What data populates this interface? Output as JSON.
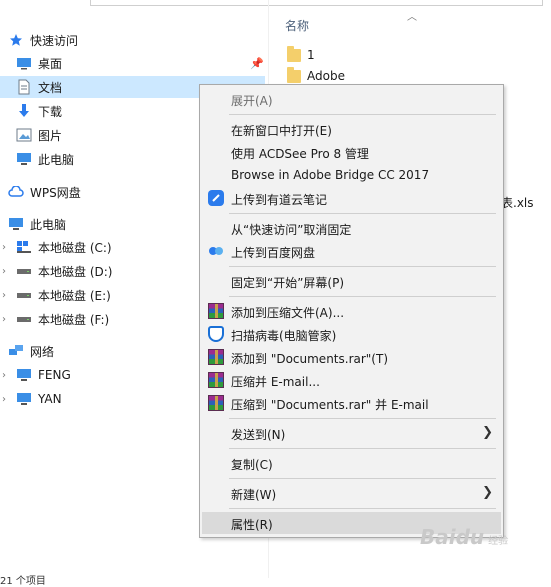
{
  "nav": {
    "quick_access": "快速访问",
    "desktop": "桌面",
    "documents": "文档",
    "downloads": "下载",
    "pictures": "图片",
    "this_pc_q": "此电脑",
    "wps": "WPS网盘",
    "this_pc": "此电脑",
    "disk_c": "本地磁盘 (C:)",
    "disk_d": "本地磁盘 (D:)",
    "disk_e": "本地磁盘 (E:)",
    "disk_f": "本地磁盘 (F:)",
    "network": "网络",
    "feng": "FENG",
    "yan": "YAN"
  },
  "files": {
    "column_name": "名称",
    "items": [
      "1",
      "Adobe"
    ],
    "xls_tail": "表.xls"
  },
  "menu": {
    "expand": "展开(A)",
    "open_new_window": "在新窗口中打开(E)",
    "acdsee": "使用 ACDSee Pro 8 管理",
    "bridge": "Browse in Adobe Bridge CC 2017",
    "youdao": "上传到有道云笔记",
    "unpin": "从“快速访问”取消固定",
    "baidu": "上传到百度网盘",
    "pin_start": "固定到“开始”屏幕(P)",
    "add_archive": "添加到压缩文件(A)...",
    "scan": "扫描病毒(电脑管家)",
    "add_rar": "添加到 \"Documents.rar\"(T)",
    "compress_email": "压缩并 E-mail...",
    "compress_rar_email": "压缩到 \"Documents.rar\" 并 E-mail",
    "send_to": "发送到(N)",
    "copy": "复制(C)",
    "new": "新建(W)",
    "properties": "属性(R)"
  },
  "status": "21 个项目",
  "watermark": "Baidu",
  "watermark_sub": "经验"
}
